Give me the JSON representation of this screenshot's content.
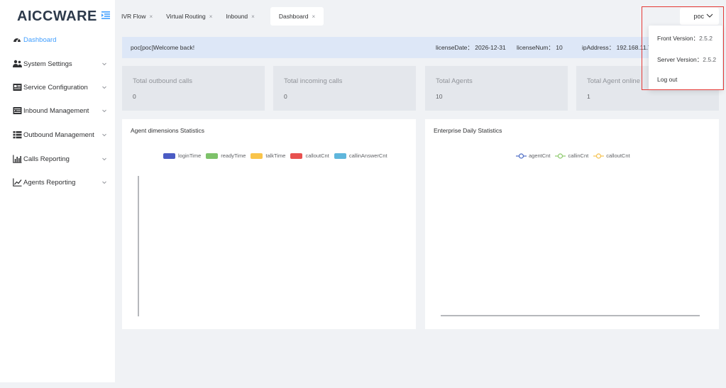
{
  "app": {
    "logo_part1": "AICC",
    "logo_part2": "WARE"
  },
  "sidebar": {
    "items": [
      {
        "label": "Dashboard",
        "icon": "dashboard-icon"
      },
      {
        "label": "System Settings",
        "icon": "users-icon"
      },
      {
        "label": "Service Configuration",
        "icon": "service-config-icon"
      },
      {
        "label": "Inbound Management",
        "icon": "inbound-list-icon"
      },
      {
        "label": "Outbound Management",
        "icon": "outbound-list-icon"
      },
      {
        "label": "Calls Reporting",
        "icon": "bar-chart-icon"
      },
      {
        "label": "Agents Reporting",
        "icon": "line-chart-icon"
      }
    ]
  },
  "tabs": [
    {
      "label": "IVR Flow"
    },
    {
      "label": "Virtual Routing"
    },
    {
      "label": "Inbound"
    },
    {
      "label": "Dashboard"
    }
  ],
  "user": {
    "name": "poc"
  },
  "banner": {
    "welcome": "poc[poc]Welcome back!",
    "license_date": "licenseDate： 2026-12-31",
    "license_num": "licenseNum： 10",
    "ip_address": "ipAddress： 192.168.11.7"
  },
  "cards": [
    {
      "title": "Total outbound calls",
      "value": "0"
    },
    {
      "title": "Total incoming calls",
      "value": "0"
    },
    {
      "title": "Total Agents",
      "value": "10"
    },
    {
      "title": "Total Agent online",
      "value": "1"
    }
  ],
  "panels": {
    "agent_title": "Agent dimensions Statistics",
    "enterprise_title": "Enterprise Daily Statistics"
  },
  "dropdown": {
    "front_label": "Front Version：",
    "front_value": "2.5.2",
    "server_label": "Server Version：",
    "server_value": "2.5.2",
    "logout": "Log out"
  },
  "colors": {
    "accent": "#409eff",
    "highlight": "#e53935"
  },
  "chart_data": [
    {
      "type": "bar",
      "title": "Agent dimensions Statistics",
      "series": [
        {
          "name": "loginTime",
          "color": "#4b5cc4",
          "values": []
        },
        {
          "name": "readyTime",
          "color": "#7ec26a",
          "values": []
        },
        {
          "name": "talkTime",
          "color": "#f9c44a",
          "values": []
        },
        {
          "name": "calloutCnt",
          "color": "#e8514f",
          "values": []
        },
        {
          "name": "callinAnswerCnt",
          "color": "#5fb6dc",
          "values": []
        }
      ],
      "categories": [],
      "legend": "top-center"
    },
    {
      "type": "line",
      "title": "Enterprise Daily Statistics",
      "series": [
        {
          "name": "agentCnt",
          "color": "#4b6bc4",
          "values": []
        },
        {
          "name": "callinCnt",
          "color": "#8cc96b",
          "values": []
        },
        {
          "name": "calloutCnt",
          "color": "#f5c04c",
          "values": []
        }
      ],
      "categories": [],
      "legend": "top-center"
    }
  ]
}
